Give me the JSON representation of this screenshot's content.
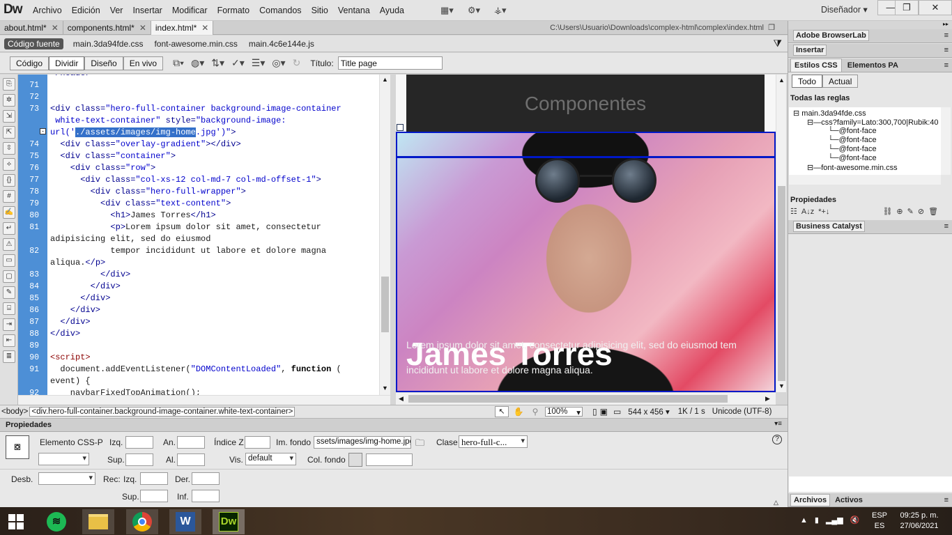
{
  "app": {
    "logo": "Dw",
    "workspace": "Diseñador"
  },
  "menu": [
    "Archivo",
    "Edición",
    "Ver",
    "Insertar",
    "Modificar",
    "Formato",
    "Comandos",
    "Sitio",
    "Ventana",
    "Ayuda"
  ],
  "tabs": [
    {
      "label": "about.html*"
    },
    {
      "label": "components.html*"
    },
    {
      "label": "index.html*"
    }
  ],
  "file_path": "C:\\Users\\Usuario\\Downloads\\complex-html\\complex\\index.html",
  "related": {
    "source": "Código fuente",
    "files": [
      "main.3da94fde.css",
      "font-awesome.min.css",
      "main.4c6e144e.js"
    ]
  },
  "doc_toolbar": {
    "views": [
      "Código",
      "Dividir",
      "Diseño",
      "En vivo"
    ],
    "title_label": "Título:",
    "title_value": "Title page"
  },
  "code": {
    "top_fragment": "</header>",
    "line_numbers": [
      "71",
      "72",
      "73",
      "74",
      "75",
      "76",
      "77",
      "78",
      "79",
      "80",
      "81",
      "82",
      "83",
      "84",
      "85",
      "86",
      "87",
      "88",
      "89",
      "90",
      "91",
      "92"
    ]
  },
  "design": {
    "header": "Componentes",
    "hero_title": "James Torres",
    "hero_p1": "Lorem ipsum dolor sit amet, consectetur adipisicing elit, sed do eiusmod tem",
    "hero_p2": "incididunt ut labore et dolore magna aliqua."
  },
  "status": {
    "body": "<body>",
    "tag": "<div.hero-full-container.background-image-container.white-text-container>",
    "zoom": "100%",
    "size": "544 x 456",
    "kb": "1K / 1 s",
    "encoding": "Unicode (UTF-8)"
  },
  "properties": {
    "title": "Propiedades",
    "element": "Elemento CSS-P",
    "izq": "Izq.",
    "an": "An.",
    "indice_z": "Índice Z",
    "im_fondo": "Im. fondo",
    "im_fondo_value": "ssets/images/img-home.jpg",
    "clase": "Clase",
    "clase_value": "hero-full-c...",
    "sup": "Sup.",
    "al": "Al.",
    "vis": "Vis.",
    "vis_value": "default",
    "col_fondo": "Col. fondo",
    "desb": "Desb.",
    "rec": "Rec:",
    "rec_izq": "Izq.",
    "rec_der": "Der.",
    "rec_sup": "Sup.",
    "rec_inf": "Inf."
  },
  "right_panel": {
    "browserlab": "Adobe BrowserLab",
    "insertar": "Insertar",
    "tabs": [
      "Estilos CSS",
      "Elementos PA"
    ],
    "toggle": [
      "Todo",
      "Actual"
    ],
    "rules_title": "Todas las reglas",
    "tree": [
      "main.3da94fde.css",
      "css?family=Lato:300,700|Rubik:40",
      "@font-face",
      "@font-face",
      "@font-face",
      "@font-face",
      "font-awesome.min.css"
    ],
    "propiedades": "Propiedades",
    "business": "Business Catalyst",
    "bottom_tabs": [
      "Archivos",
      "Activos"
    ]
  },
  "taskbar": {
    "lang1": "ESP",
    "lang2": "ES",
    "time": "09:25 p. m.",
    "date": "27/06/2021"
  },
  "colors": {
    "gutter": "#4d8fd6",
    "selection": "#0018c8",
    "spotify": "#1db954",
    "word": "#2b579a",
    "dw": "#a8d52a"
  }
}
